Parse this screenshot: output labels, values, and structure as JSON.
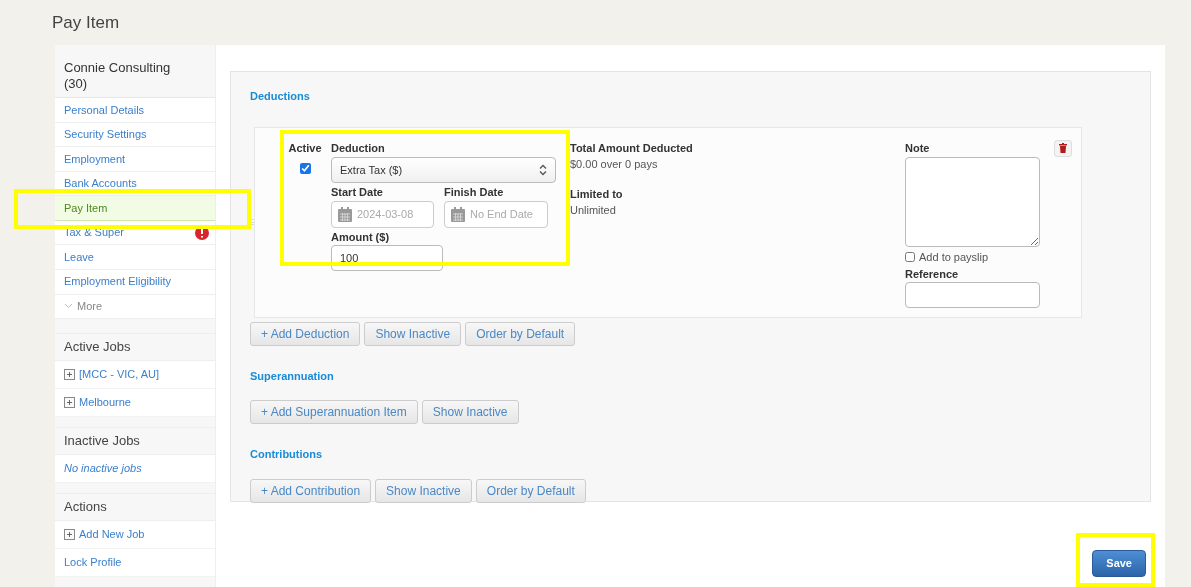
{
  "page_title": "Pay Item",
  "sidebar": {
    "header": "Connie Consulting (30)",
    "items": [
      {
        "label": "Personal Details",
        "selected": false,
        "alert": false
      },
      {
        "label": "Security Settings",
        "selected": false,
        "alert": false
      },
      {
        "label": "Employment",
        "selected": false,
        "alert": false
      },
      {
        "label": "Bank Accounts",
        "selected": false,
        "alert": false
      },
      {
        "label": "Pay Item",
        "selected": true,
        "alert": false
      },
      {
        "label": "Tax & Super",
        "selected": false,
        "alert": true
      },
      {
        "label": "Leave",
        "selected": false,
        "alert": false
      },
      {
        "label": "Employment Eligibility",
        "selected": false,
        "alert": false
      }
    ],
    "more": "More",
    "sections": [
      {
        "title": "Active Jobs",
        "items": [
          {
            "label": "[MCC - VIC, AU]",
            "kind": "expand"
          },
          {
            "label": "Melbourne",
            "kind": "expand"
          }
        ]
      },
      {
        "title": "Inactive Jobs",
        "items": [
          {
            "label": "No inactive jobs",
            "kind": "empty"
          }
        ]
      },
      {
        "title": "Actions",
        "items": [
          {
            "label": "Add New Job",
            "kind": "expand"
          },
          {
            "label": "Lock Profile",
            "kind": "link"
          }
        ]
      }
    ]
  },
  "deductions": {
    "title": "Deductions",
    "item": {
      "active_label": "Active",
      "active": true,
      "deduction_label": "Deduction",
      "deduction_value": "Extra Tax ($)",
      "start_label": "Start Date",
      "start_value": "2024-03-08",
      "finish_label": "Finish Date",
      "finish_placeholder": "No End Date",
      "amount_label": "Amount ($)",
      "amount_value": "100",
      "total_label": "Total Amount Deducted",
      "total_value": "$0.00 over 0 pays",
      "limit_label": "Limited to",
      "limit_value": "Unlimited",
      "note_label": "Note",
      "add_to_payslip_label": "Add to payslip",
      "add_to_payslip": false,
      "reference_label": "Reference"
    },
    "buttons": [
      "+ Add Deduction",
      "Show Inactive",
      "Order by Default"
    ]
  },
  "superannuation": {
    "title": "Superannuation",
    "buttons": [
      "+ Add Superannuation Item",
      "Show Inactive"
    ]
  },
  "contributions": {
    "title": "Contributions",
    "buttons": [
      "+ Add Contribution",
      "Show Inactive",
      "Order by Default"
    ]
  },
  "save_button": "Save"
}
